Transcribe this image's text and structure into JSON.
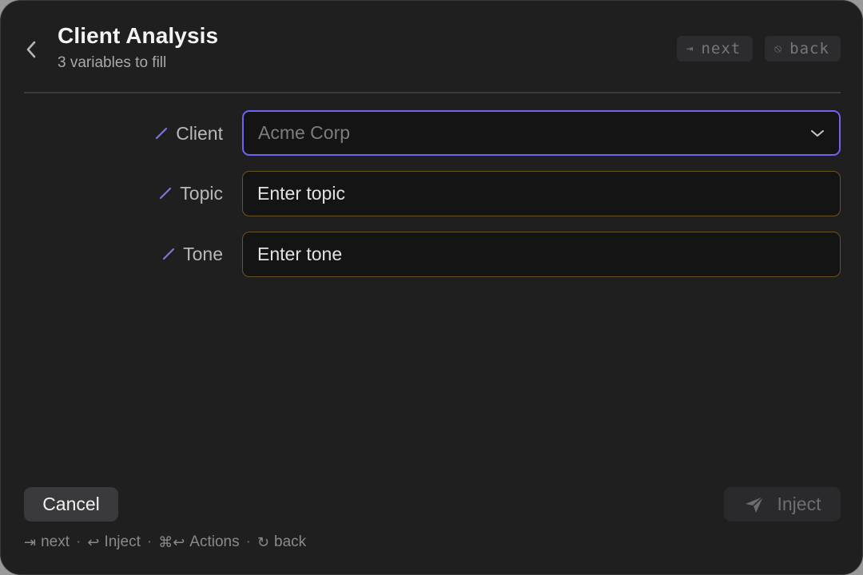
{
  "header": {
    "title": "Client Analysis",
    "subtitle": "3 variables to fill",
    "hints": [
      {
        "glyph": "⇥",
        "label": "next"
      },
      {
        "glyph": "⦸",
        "label": "back"
      }
    ]
  },
  "form": {
    "client": {
      "label": "Client",
      "placeholder": "Acme Corp"
    },
    "topic": {
      "label": "Topic",
      "placeholder": "Enter topic"
    },
    "tone": {
      "label": "Tone",
      "placeholder": "Enter tone"
    }
  },
  "footer": {
    "cancel_label": "Cancel",
    "inject_label": "Inject",
    "shortcuts": [
      {
        "sym": "⇥",
        "label": "next"
      },
      {
        "sym": "↩",
        "label": "Inject"
      },
      {
        "sym": "⌘↩",
        "label": "Actions"
      },
      {
        "sym": "↻",
        "label": "back"
      }
    ],
    "separator": "·"
  },
  "colors": {
    "background": "#1f1f20",
    "accent": "#6f63f0",
    "field_border": "#6a5320"
  },
  "icons": [
    "chevron-left-icon",
    "pencil-icon",
    "chevron-down-icon",
    "paper-plane-icon"
  ]
}
